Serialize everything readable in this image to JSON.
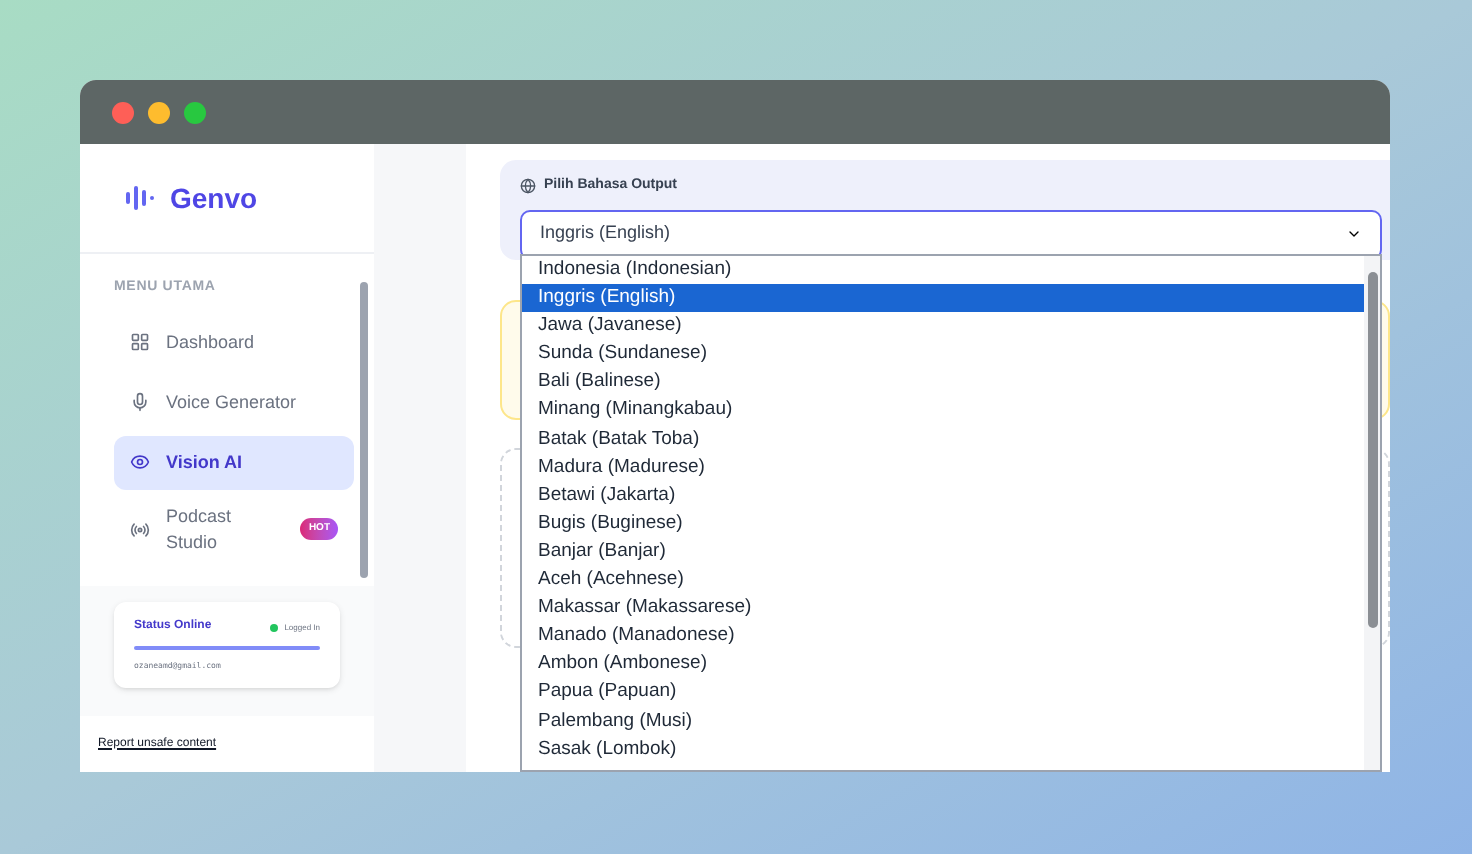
{
  "sidebar": {
    "brand": "Genvo",
    "menu_heading": "MENU UTAMA",
    "items": [
      {
        "label": "Dashboard",
        "selected": false
      },
      {
        "label": "Voice Generator",
        "selected": false
      },
      {
        "label": "Vision AI",
        "selected": true
      },
      {
        "label": "Podcast Studio",
        "selected": false,
        "badge": "HOT"
      }
    ],
    "status": {
      "title": "Status Online",
      "state": "Logged In",
      "email": "ozaneamd@gmail.com"
    }
  },
  "report_link": "Report unsafe content",
  "language": {
    "label": "Pilih Bahasa Output",
    "value": "Inggris (English)",
    "options": [
      {
        "label": "Indonesia (Indonesian)",
        "selected": false
      },
      {
        "label": "Inggris (English)",
        "selected": true
      },
      {
        "label": "Jawa (Javanese)",
        "selected": false
      },
      {
        "label": "Sunda (Sundanese)",
        "selected": false
      },
      {
        "label": "Bali (Balinese)",
        "selected": false
      },
      {
        "label": "Minang (Minangkabau)",
        "selected": false
      },
      {
        "label": "Batak (Batak Toba)",
        "selected": false
      },
      {
        "label": "Madura (Madurese)",
        "selected": false
      },
      {
        "label": "Betawi (Jakarta)",
        "selected": false
      },
      {
        "label": "Bugis (Buginese)",
        "selected": false
      },
      {
        "label": "Banjar (Banjar)",
        "selected": false
      },
      {
        "label": "Aceh (Acehnese)",
        "selected": false
      },
      {
        "label": "Makassar (Makassarese)",
        "selected": false
      },
      {
        "label": "Manado (Manadonese)",
        "selected": false
      },
      {
        "label": "Ambon (Ambonese)",
        "selected": false
      },
      {
        "label": "Papua (Papuan)",
        "selected": false
      },
      {
        "label": "Palembang (Musi)",
        "selected": false
      },
      {
        "label": "Sasak (Lombok)",
        "selected": false
      }
    ]
  }
}
